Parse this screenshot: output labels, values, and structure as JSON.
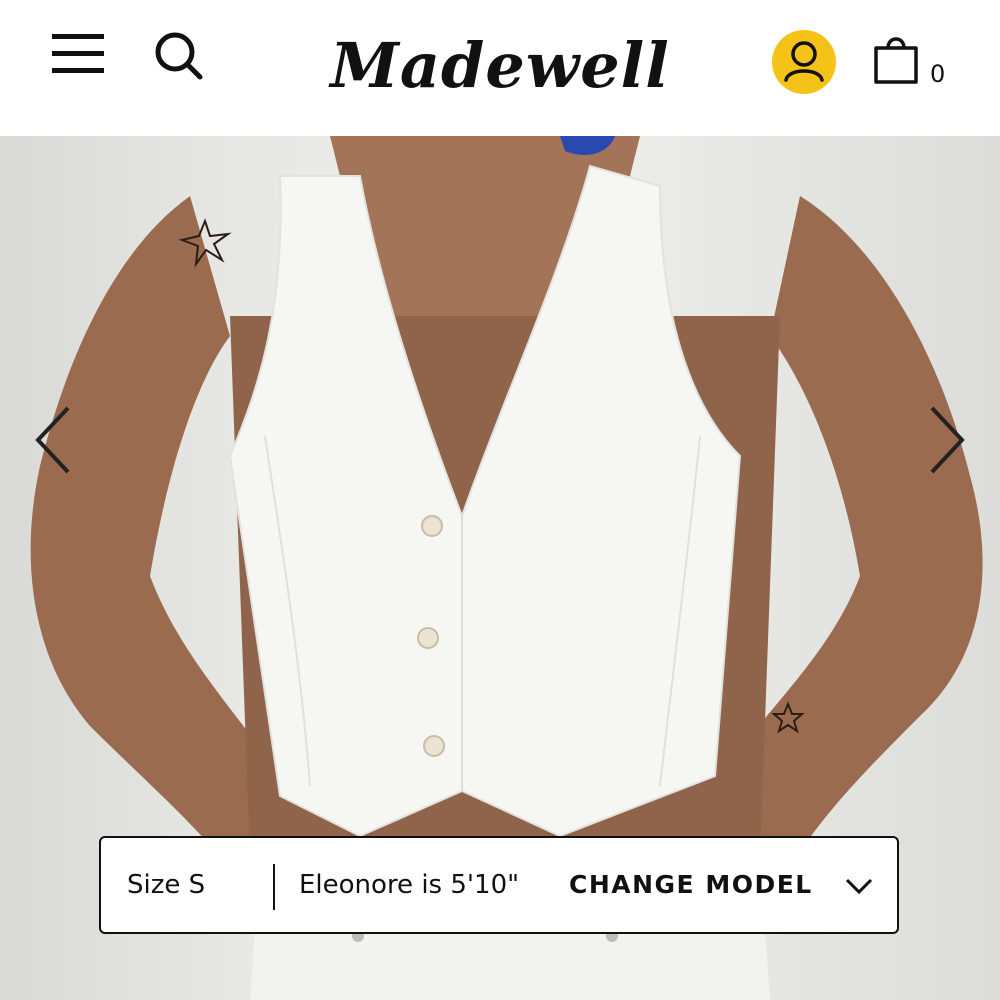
{
  "header": {
    "brand": "Madewell",
    "bag_count": "0",
    "icons": {
      "menu": "hamburger-menu-icon",
      "search": "search-icon",
      "account": "user-icon",
      "bag": "shopping-bag-icon"
    },
    "account_color": "#f5c218"
  },
  "carousel": {
    "prev_icon": "chevron-left-icon",
    "next_icon": "chevron-right-icon"
  },
  "size_bar": {
    "size_label": "Size S",
    "model_text": "Eleonore is 5'10\"",
    "change_model_label": "CHANGE MODEL",
    "dropdown_icon": "chevron-down-icon"
  }
}
